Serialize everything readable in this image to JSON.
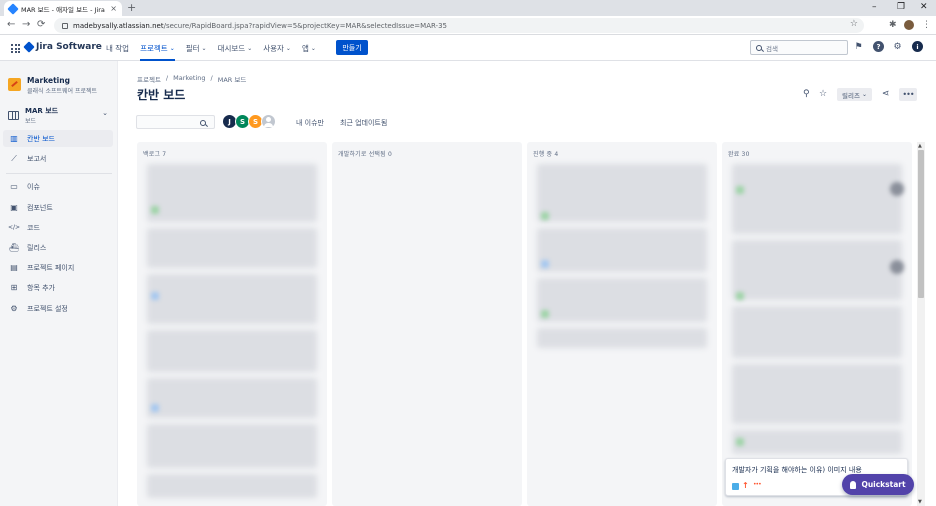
{
  "browser": {
    "tab_title": "MAR 보드 - 애자일 보드 - Jira",
    "tab_close": "×",
    "new_tab": "+",
    "url_host": "madebysally.atlassian.net",
    "url_path": "/secure/RapidBoard.jspa?rapidView=5&projectKey=MAR&selectedIssue=MAR-35",
    "window_controls": {
      "minimize": "–",
      "restore": "❐",
      "close": "✕"
    },
    "nav": {
      "back": "←",
      "forward": "→",
      "reload": "⟳"
    }
  },
  "topnav": {
    "product": "Jira Software",
    "items": [
      {
        "label": "내 작업",
        "dropdown": false,
        "active": false
      },
      {
        "label": "프로젝트",
        "dropdown": true,
        "active": true
      },
      {
        "label": "필터",
        "dropdown": true,
        "active": false
      },
      {
        "label": "대시보드",
        "dropdown": true,
        "active": false
      },
      {
        "label": "사용자",
        "dropdown": true,
        "active": false
      },
      {
        "label": "앱",
        "dropdown": true,
        "active": false
      }
    ],
    "create_label": "만들기",
    "search_placeholder": "검색",
    "user_initial": "i",
    "help_glyph": "?"
  },
  "sidebar": {
    "project_name": "Marketing",
    "project_type": "클래식 소프트웨어 프로젝트",
    "board_name": "MAR 보드",
    "board_sub": "보드",
    "items_top": [
      {
        "label": "칸반 보드",
        "icon": "board-icon",
        "glyph": "▥",
        "active": true
      },
      {
        "label": "보고서",
        "icon": "reports-icon",
        "glyph": "⟋",
        "active": false
      }
    ],
    "items_bottom": [
      {
        "label": "이슈",
        "icon": "issues-icon",
        "glyph": "▭"
      },
      {
        "label": "컴포넌트",
        "icon": "components-icon",
        "glyph": "▣"
      },
      {
        "label": "코드",
        "icon": "code-icon",
        "glyph": "</>"
      },
      {
        "label": "릴리스",
        "icon": "releases-icon",
        "glyph": "⛴"
      },
      {
        "label": "프로젝트 페이지",
        "icon": "pages-icon",
        "glyph": "▤"
      },
      {
        "label": "항목 추가",
        "icon": "add-item-icon",
        "glyph": "⊞"
      },
      {
        "label": "프로젝트 설정",
        "icon": "settings-icon",
        "glyph": "⚙"
      }
    ]
  },
  "main": {
    "breadcrumb": [
      "프로젝트",
      "/",
      "Marketing",
      "/",
      "MAR 보드"
    ],
    "title": "칸반 보드",
    "release_label": "릴리즈",
    "more_glyph": "•••",
    "avatars": [
      {
        "initial": "J",
        "color": "#172b4d"
      },
      {
        "initial": "S",
        "color": "#00875a"
      },
      {
        "initial": "S",
        "color": "#ff991f"
      }
    ],
    "filters": [
      "내 이슈만",
      "최근 업데이트됨"
    ],
    "columns": [
      {
        "name": "백로그 7"
      },
      {
        "name": "개발하기로 선택됨 0"
      },
      {
        "name": "진행 중 4"
      },
      {
        "name": "완료 30"
      }
    ],
    "visible_card": {
      "title": "개발자가 기획을 해야하는 이유) 이미지 내용",
      "priority_glyph": "↑",
      "dots": "•••"
    },
    "quickstart_label": "Quickstart"
  },
  "colors": {
    "brand": "#0052cc",
    "quickstart": "#5243aa",
    "sidebar_bg": "#f4f5f7"
  }
}
